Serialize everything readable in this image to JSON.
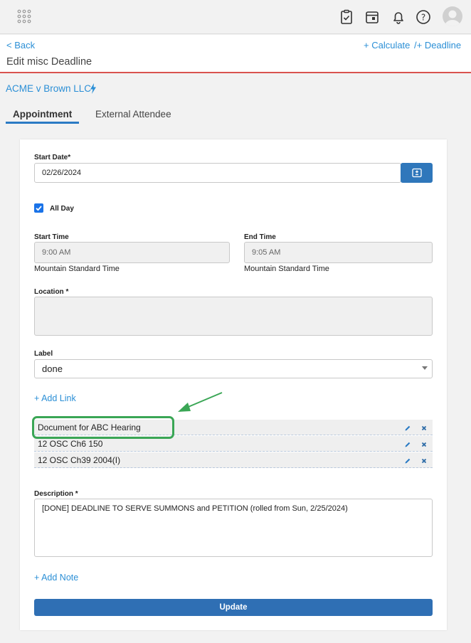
{
  "header": {
    "back_label": "< Back",
    "title": "Edit misc Deadline",
    "calculate_label": "+ Calculate",
    "deadline_label": "/+ Deadline"
  },
  "matter": {
    "name": "ACME v Brown LLC"
  },
  "tabs": [
    {
      "label": "Appointment",
      "active": true
    },
    {
      "label": "External Attendee",
      "active": false
    }
  ],
  "form": {
    "start_date": {
      "label": "Start Date*",
      "value": "02/26/2024"
    },
    "all_day": {
      "label": "All Day",
      "checked": true
    },
    "start_time": {
      "label": "Start Time",
      "value": "9:00 AM",
      "timezone": "Mountain Standard Time"
    },
    "end_time": {
      "label": "End Time",
      "value": "9:05 AM",
      "timezone": "Mountain Standard Time"
    },
    "location": {
      "label": "Location *",
      "value": ""
    },
    "label_field": {
      "label": "Label",
      "value": "done"
    },
    "add_link_label": "+ Add Link",
    "links": [
      "Document for ABC Hearing",
      "12 OSC Ch6 150",
      "12 OSC Ch39 2004(I)"
    ],
    "description": {
      "label": "Description *",
      "value": "[DONE] DEADLINE TO SERVE SUMMONS and PETITION (rolled from Sun, 2/25/2024)"
    },
    "add_note_label": "+ Add Note",
    "update_label": "Update"
  },
  "colors": {
    "accent": "#2b8fd6",
    "primary_button": "#2f6fb4",
    "header_rule": "#d9534f",
    "highlight": "#3aa655"
  },
  "icons": {
    "top_bar": [
      "apps-grid-icon",
      "clipboard-check-icon",
      "calendar-icon",
      "bell-icon",
      "help-icon",
      "user-avatar-icon"
    ],
    "row_actions": [
      "pencil-icon",
      "close-icon"
    ]
  }
}
